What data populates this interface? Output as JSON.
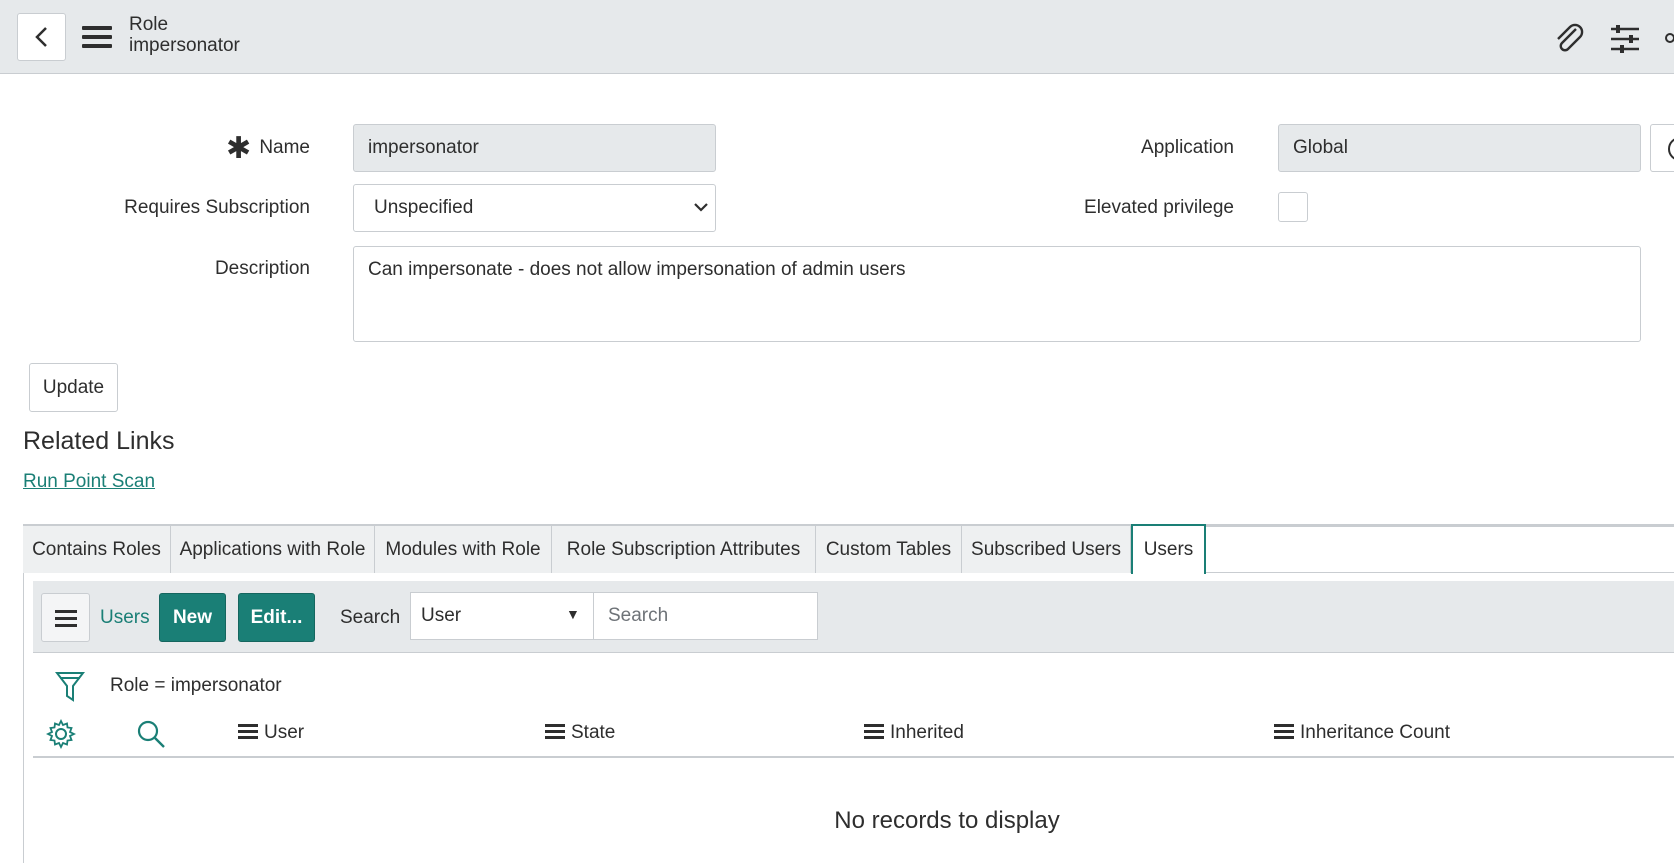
{
  "header": {
    "title": "Role",
    "subtitle": "impersonator"
  },
  "form": {
    "name_label": "Name",
    "required_mark": "✱",
    "name_value": "impersonator",
    "application_label": "Application",
    "application_value": "Global",
    "requires_subscription_label": "Requires Subscription",
    "requires_subscription_value": "Unspecified",
    "elevated_privilege_label": "Elevated privilege",
    "description_label": "Description",
    "description_value": "Can impersonate - does not allow impersonation of admin users",
    "update_label": "Update"
  },
  "related_links": {
    "title": "Related Links",
    "links": [
      "Run Point Scan"
    ]
  },
  "tabs": [
    {
      "label": "Contains Roles",
      "active": false
    },
    {
      "label": "Applications with Role",
      "active": false
    },
    {
      "label": "Modules with Role",
      "active": false
    },
    {
      "label": "Role Subscription Attributes",
      "active": false
    },
    {
      "label": "Custom Tables",
      "active": false
    },
    {
      "label": "Subscribed Users",
      "active": false
    },
    {
      "label": "Users",
      "active": true
    }
  ],
  "list": {
    "title": "Users",
    "new_label": "New",
    "edit_label": "Edit...",
    "search_label": "Search",
    "search_field": "User",
    "search_placeholder": "Search",
    "filter": "Role = impersonator",
    "columns": [
      "User",
      "State",
      "Inherited",
      "Inheritance Count"
    ],
    "empty_message": "No records to display"
  },
  "colors": {
    "accent": "#1a7f76",
    "header_bg": "#e6e9eb"
  }
}
